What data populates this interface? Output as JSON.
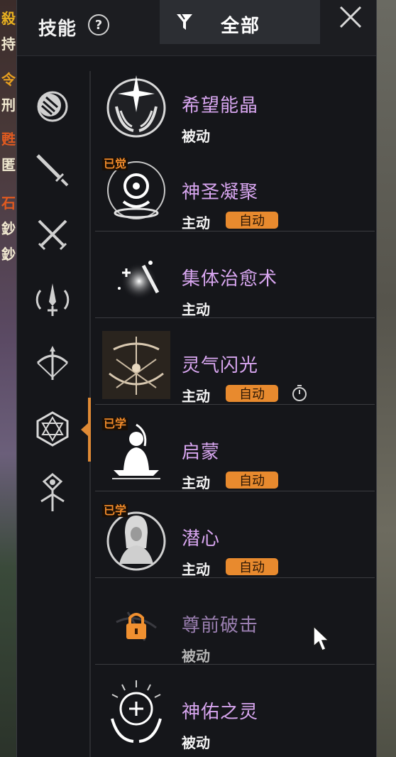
{
  "background": {
    "left_chars": [
      "殺",
      "持",
      "令",
      "刑",
      "甦",
      "匿",
      "石",
      "鈔",
      "鈔"
    ]
  },
  "header": {
    "title": "技能",
    "help_icon": "?",
    "filter_label": "全部"
  },
  "sidebar": {
    "categories": [
      {
        "icon": "moon-orb-icon"
      },
      {
        "icon": "sword-icon"
      },
      {
        "icon": "crossed-swords-icon"
      },
      {
        "icon": "dagger-ring-icon"
      },
      {
        "icon": "bow-icon"
      },
      {
        "icon": "hexagon-star-icon",
        "active": true
      },
      {
        "icon": "crystal-staff-icon"
      }
    ]
  },
  "skills": [
    {
      "name": "希望能晶",
      "type": "被动",
      "auto": false,
      "learned": false,
      "locked": false,
      "icon": "hands-star-icon"
    },
    {
      "name": "神圣凝聚",
      "type": "主动",
      "auto": true,
      "auto_label": "自动",
      "learned": true,
      "learned_label": "已觉",
      "locked": false,
      "icon": "holy-sigil-icon"
    },
    {
      "name": "集体治愈术",
      "type": "主动",
      "auto": false,
      "learned": false,
      "locked": false,
      "icon": "sparkle-heal-icon"
    },
    {
      "name": "灵气闪光",
      "type": "主动",
      "auto": true,
      "auto_label": "自动",
      "learned": false,
      "locked": false,
      "icon": "aura-flash-icon",
      "extra_icon": "timer-icon"
    },
    {
      "name": "启蒙",
      "type": "主动",
      "auto": true,
      "auto_label": "自动",
      "learned": true,
      "learned_label": "已学",
      "locked": false,
      "icon": "meditation-icon"
    },
    {
      "name": "潜心",
      "type": "主动",
      "auto": true,
      "auto_label": "自动",
      "learned": true,
      "learned_label": "已学",
      "locked": false,
      "icon": "hooded-figure-icon"
    },
    {
      "name": "尊前破击",
      "type": "被动",
      "auto": false,
      "learned": false,
      "locked": true,
      "icon": "lock-icon"
    },
    {
      "name": "神佑之灵",
      "type": "被动",
      "auto": false,
      "learned": false,
      "locked": false,
      "icon": "blessing-hands-icon"
    }
  ]
}
